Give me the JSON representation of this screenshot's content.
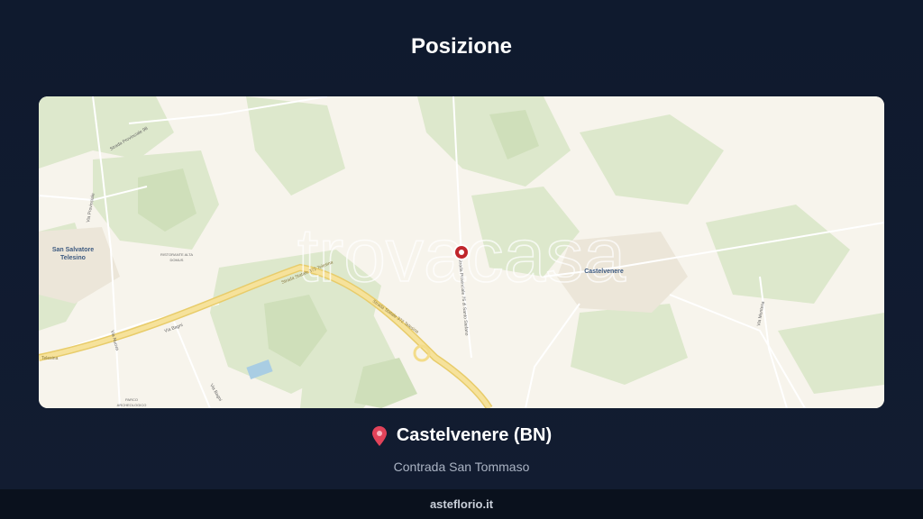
{
  "page": {
    "title": "Posizione"
  },
  "map": {
    "watermark": "trovacasa",
    "labels": {
      "san_salvatore_1": "San Salvatore",
      "san_salvatore_2": "Telesino",
      "castelvenere": "Castelvenere",
      "strada_372_a": "Strada Statale 372 Telesina",
      "strada_372_b": "Strada Statale 372 Telesina",
      "strada_prov": "Strada Provinciale 75 di Santo Stefano",
      "strada_prov_98": "Strada Provinciale 98",
      "via_provinciale": "Via Provinciale",
      "ristorante_1": "RISTORANTE ALTA",
      "ristorante_2": "DOMUS",
      "parco_1": "PARCO",
      "parco_2": "ARCHEOLOGICO",
      "telesina": "Telesina",
      "via_bagni_1": "Via Bagni",
      "via_bagni_2": "Via Bagni",
      "via_nuova": "Via Nuova",
      "via_monteuf": "Via Montesa"
    },
    "icons": {
      "marker": "location-marker-icon"
    },
    "colors": {
      "marker": "#c0262c",
      "land": "#f7f4ec",
      "green": "#dfe9cf",
      "road": "#f3dc8a"
    }
  },
  "location": {
    "pin_icon": "pin-icon",
    "name": "Castelvenere (BN)",
    "address": "Contrada San Tommaso"
  },
  "footer": {
    "site": "asteflorio.it"
  }
}
